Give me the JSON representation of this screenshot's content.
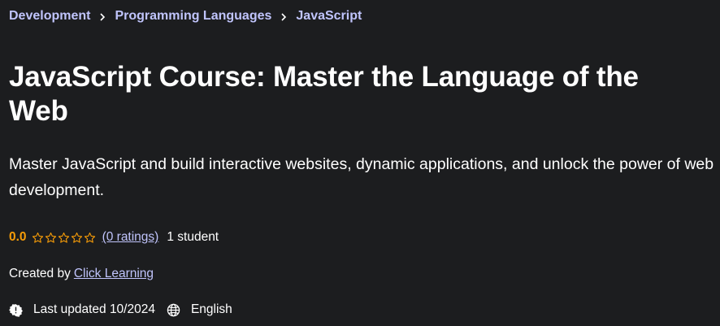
{
  "breadcrumb": {
    "items": [
      "Development",
      "Programming Languages",
      "JavaScript"
    ]
  },
  "course": {
    "title": "JavaScript Course: Master the Language of the Web",
    "subtitle": "Master JavaScript and build interactive websites, dynamic applications, and unlock the power of web development."
  },
  "rating": {
    "value": "0.0",
    "stars_filled": 0,
    "stars_total": 5,
    "ratings_link": "(0 ratings)",
    "students": "1 student"
  },
  "creator": {
    "label": "Created by",
    "name": "Click Learning"
  },
  "meta": {
    "last_updated": "Last updated 10/2024",
    "language": "English",
    "update_icon": "alert-badge-icon",
    "language_icon": "globe-icon"
  },
  "colors": {
    "background": "#1c1d1f",
    "link": "#c0c4fc",
    "rating": "#f69c08",
    "text": "#ffffff"
  }
}
